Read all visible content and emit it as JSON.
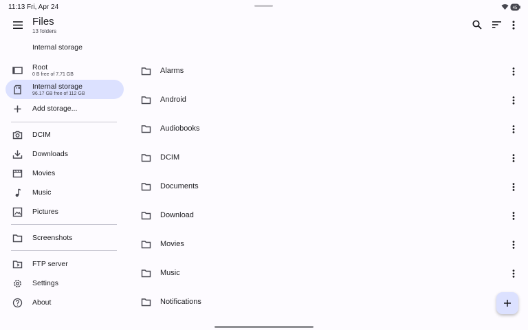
{
  "status": {
    "time": "11:13",
    "date": "Fri, Apr 24",
    "battery_icon": "battery-icon",
    "wifi_icon": "wifi-icon"
  },
  "app": {
    "title": "Files",
    "subtitle": "13 folders"
  },
  "toolbar": {
    "icons": [
      "search-icon",
      "sort-icon",
      "more-vert-icon"
    ]
  },
  "drawer": {
    "section_title": "Internal storage",
    "storage": [
      {
        "label": "Root",
        "sub": "0 B free of 7.71 GB",
        "icon": "root-storage-icon"
      },
      {
        "label": "Internal storage",
        "sub": "96.17 GB free of 112 GB",
        "icon": "sd-card-icon",
        "active": true
      },
      {
        "label": "Add storage...",
        "icon": "add-icon"
      }
    ],
    "bookmarks": [
      {
        "label": "DCIM",
        "icon": "camera-icon"
      },
      {
        "label": "Downloads",
        "icon": "download-icon"
      },
      {
        "label": "Movies",
        "icon": "movie-icon"
      },
      {
        "label": "Music",
        "icon": "music-note-icon"
      },
      {
        "label": "Pictures",
        "icon": "image-icon"
      }
    ],
    "folders": [
      {
        "label": "Screenshots",
        "icon": "folder-icon"
      }
    ],
    "other": [
      {
        "label": "FTP server",
        "icon": "ftp-icon"
      },
      {
        "label": "Settings",
        "icon": "settings-icon"
      },
      {
        "label": "About",
        "icon": "help-icon"
      }
    ]
  },
  "files": [
    {
      "name": "Alarms"
    },
    {
      "name": "Android"
    },
    {
      "name": "Audiobooks"
    },
    {
      "name": "DCIM"
    },
    {
      "name": "Documents"
    },
    {
      "name": "Download"
    },
    {
      "name": "Movies"
    },
    {
      "name": "Music"
    },
    {
      "name": "Notifications"
    }
  ],
  "colors": {
    "accent_container": "#dce1ff",
    "background": "#fdfbff",
    "icon": "#46464f"
  }
}
